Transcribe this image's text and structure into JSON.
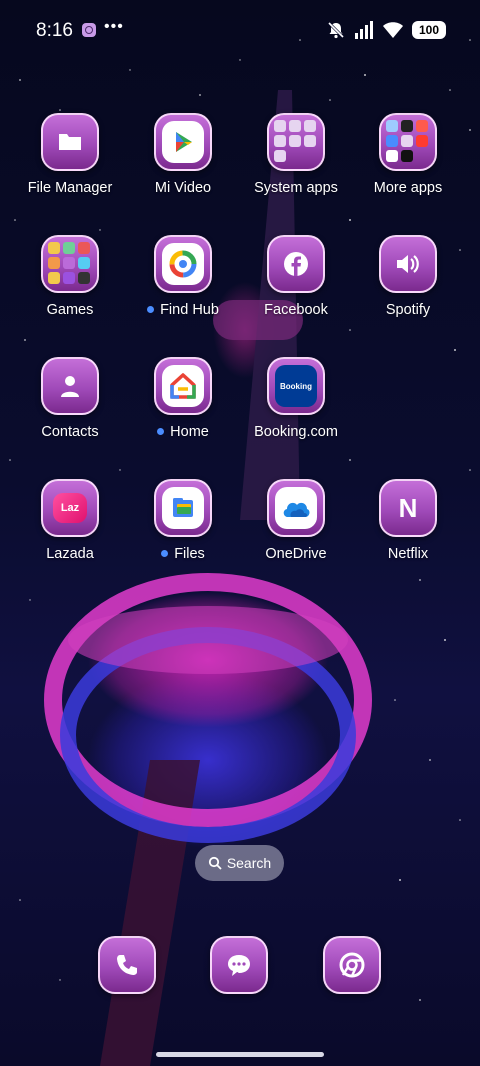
{
  "status_bar": {
    "time": "8:16",
    "dots": "•••",
    "battery": "100"
  },
  "apps": [
    {
      "label": "File Manager",
      "icon": "folder-icon",
      "dot": false
    },
    {
      "label": "Mi Video",
      "icon": "play-icon",
      "dot": false
    },
    {
      "label": "System apps",
      "icon": "folder-grid-icon",
      "dot": false
    },
    {
      "label": "More apps",
      "icon": "folder-grid-icon",
      "dot": false
    },
    {
      "label": "Games",
      "icon": "folder-grid-icon",
      "dot": false
    },
    {
      "label": "Find Hub",
      "icon": "find-hub-icon",
      "dot": true
    },
    {
      "label": "Facebook",
      "icon": "facebook-icon",
      "dot": false
    },
    {
      "label": "Spotify",
      "icon": "speaker-icon",
      "dot": false
    },
    {
      "label": "Contacts",
      "icon": "person-icon",
      "dot": false
    },
    {
      "label": "Home",
      "icon": "home-icon",
      "dot": true
    },
    {
      "label": "Booking.com",
      "icon": "booking-icon",
      "dot": false
    },
    {
      "label": "Lazada",
      "icon": "lazada-icon",
      "dot": false
    },
    {
      "label": "Files",
      "icon": "files-icon",
      "dot": true
    },
    {
      "label": "OneDrive",
      "icon": "cloud-icon",
      "dot": false
    },
    {
      "label": "Netflix",
      "icon": "netflix-icon",
      "dot": false
    }
  ],
  "icon_text": {
    "booking": "Booking",
    "lazada": "Laz",
    "netflix": "N"
  },
  "search": {
    "label": "Search"
  },
  "dock": [
    {
      "icon": "phone-icon"
    },
    {
      "icon": "messages-icon"
    },
    {
      "icon": "chrome-icon"
    }
  ],
  "colors": {
    "tile": "#a04ab9",
    "notification_dot": "#4b8dff"
  }
}
